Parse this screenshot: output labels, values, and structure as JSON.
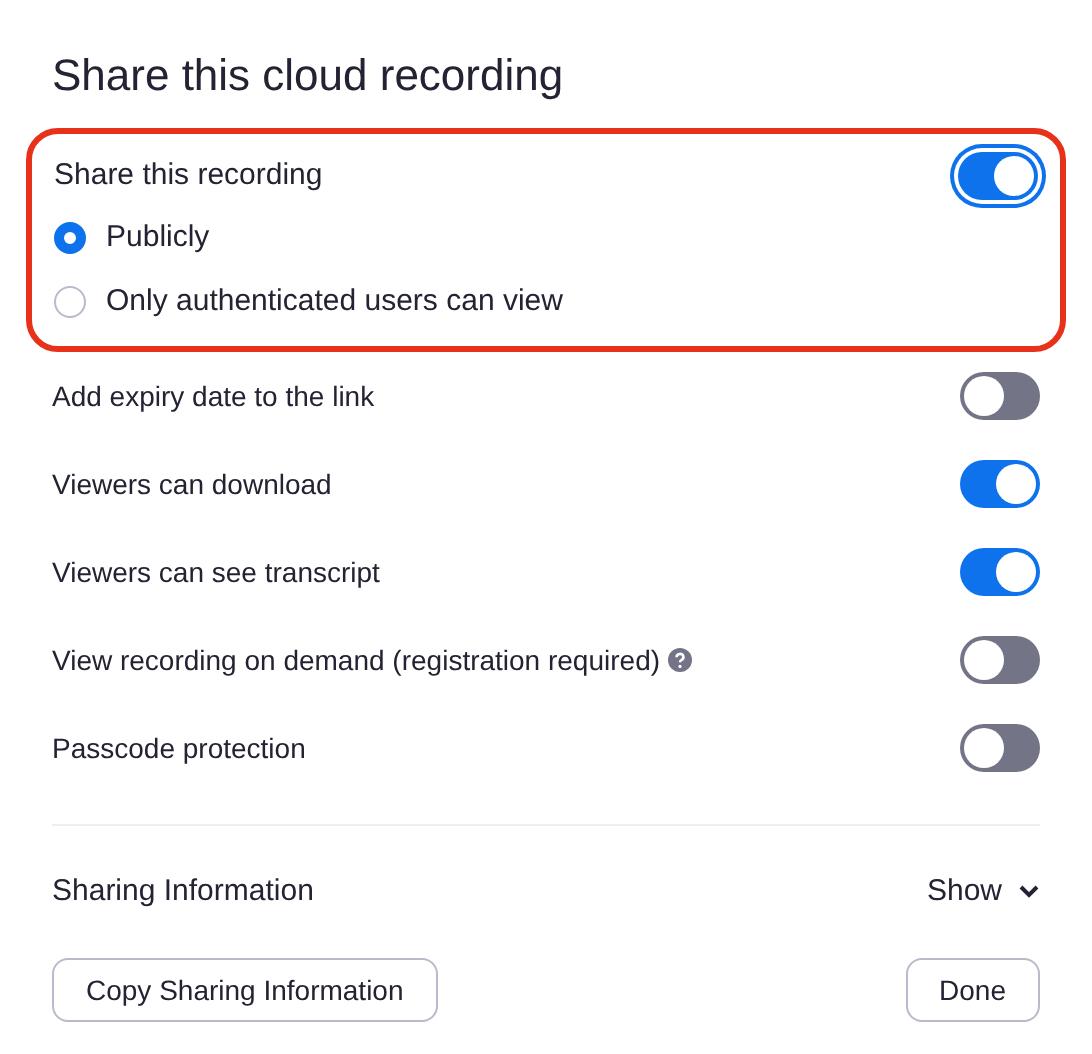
{
  "title": "Share this cloud recording",
  "share": {
    "label": "Share this recording",
    "on": true,
    "focused": true,
    "highlighted": true,
    "options": [
      {
        "label": "Publicly",
        "selected": true
      },
      {
        "label": "Only authenticated users can view",
        "selected": false
      }
    ]
  },
  "settings": [
    {
      "label": "Add expiry date to the link",
      "on": false,
      "help": false
    },
    {
      "label": "Viewers can download",
      "on": true,
      "help": false
    },
    {
      "label": "Viewers can see transcript",
      "on": true,
      "help": false
    },
    {
      "label": "View recording on demand (registration required)",
      "on": false,
      "help": true
    },
    {
      "label": "Passcode protection",
      "on": false,
      "help": false
    }
  ],
  "sharing_info": {
    "label": "Sharing Information",
    "toggle": "Show"
  },
  "buttons": {
    "copy": "Copy Sharing Information",
    "done": "Done"
  }
}
